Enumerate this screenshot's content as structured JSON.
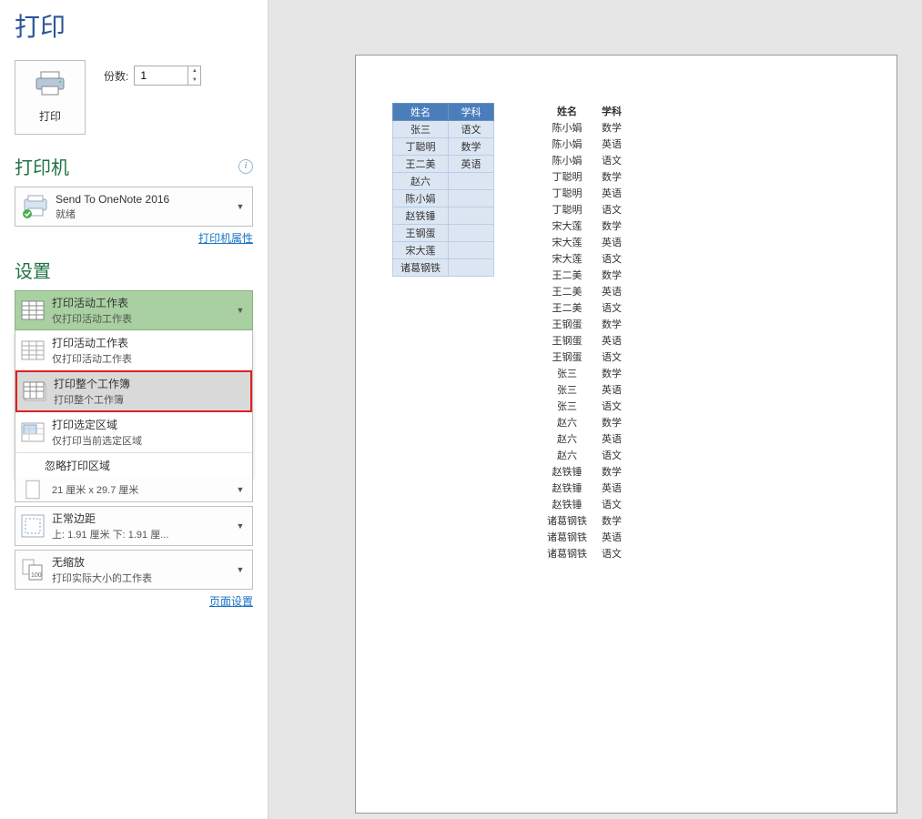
{
  "page_title": "打印",
  "print_button_label": "打印",
  "copies_label": "份数:",
  "copies_value": "1",
  "printer_heading": "打印机",
  "printer": {
    "name": "Send To OneNote 2016",
    "status": "就绪"
  },
  "printer_props_link": "打印机属性",
  "settings_heading": "设置",
  "selected_scope": {
    "title": "打印活动工作表",
    "sub": "仅打印活动工作表"
  },
  "scope_options": [
    {
      "title": "打印活动工作表",
      "sub": "仅打印活动工作表"
    },
    {
      "title": "打印整个工作簿",
      "sub": "打印整个工作簿"
    },
    {
      "title": "打印选定区域",
      "sub": "仅打印当前选定区域"
    }
  ],
  "ignore_area_label": "忽略打印区域",
  "paper_sub": "21 厘米 x 29.7 厘米",
  "margins": {
    "title": "正常边距",
    "sub": "上: 1.91 厘米 下: 1.91 厘..."
  },
  "scaling": {
    "title": "无缩放",
    "sub": "打印实际大小的工作表"
  },
  "page_setup_link": "页面设置",
  "table_left_headers": [
    "姓名",
    "学科"
  ],
  "table_left": [
    [
      "张三",
      "语文"
    ],
    [
      "丁聪明",
      "数学"
    ],
    [
      "王二美",
      "英语"
    ],
    [
      "赵六",
      ""
    ],
    [
      "陈小娟",
      ""
    ],
    [
      "赵铁锤",
      ""
    ],
    [
      "王钢蛋",
      ""
    ],
    [
      "宋大莲",
      ""
    ],
    [
      "诸葛钢铁",
      ""
    ]
  ],
  "table_right_headers": [
    "姓名",
    "学科"
  ],
  "table_right": [
    [
      "陈小娟",
      "数学"
    ],
    [
      "陈小娟",
      "英语"
    ],
    [
      "陈小娟",
      "语文"
    ],
    [
      "丁聪明",
      "数学"
    ],
    [
      "丁聪明",
      "英语"
    ],
    [
      "丁聪明",
      "语文"
    ],
    [
      "宋大莲",
      "数学"
    ],
    [
      "宋大莲",
      "英语"
    ],
    [
      "宋大莲",
      "语文"
    ],
    [
      "王二美",
      "数学"
    ],
    [
      "王二美",
      "英语"
    ],
    [
      "王二美",
      "语文"
    ],
    [
      "王钢蛋",
      "数学"
    ],
    [
      "王钢蛋",
      "英语"
    ],
    [
      "王钢蛋",
      "语文"
    ],
    [
      "张三",
      "数学"
    ],
    [
      "张三",
      "英语"
    ],
    [
      "张三",
      "语文"
    ],
    [
      "赵六",
      "数学"
    ],
    [
      "赵六",
      "英语"
    ],
    [
      "赵六",
      "语文"
    ],
    [
      "赵铁锤",
      "数学"
    ],
    [
      "赵铁锤",
      "英语"
    ],
    [
      "赵铁锤",
      "语文"
    ],
    [
      "诸葛钢铁",
      "数学"
    ],
    [
      "诸葛钢铁",
      "英语"
    ],
    [
      "诸葛钢铁",
      "语文"
    ]
  ]
}
